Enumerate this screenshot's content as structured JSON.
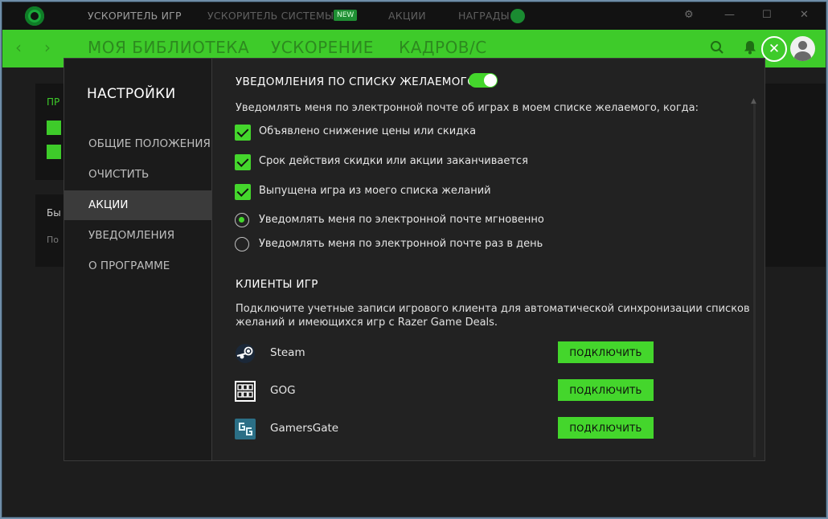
{
  "topbar": {
    "tabs": [
      "УСКОРИТЕЛЬ ИГР",
      "УСКОРИТЕЛЬ СИСТЕМЫ",
      "АКЦИИ",
      "НАГРАДЫ"
    ],
    "new_badge": "NEW",
    "window_buttons": [
      "⚙",
      "—",
      "☐",
      "✕"
    ]
  },
  "header": {
    "tabs": [
      "МОЯ БИБЛИОТЕКА",
      "УСКОРЕНИЕ",
      "КАДРОВ/С"
    ],
    "back": "‹",
    "forward": "›",
    "close": "✕"
  },
  "background_page": {
    "card1_label": "ПР",
    "card2_label": "Бы",
    "card2_text": "По"
  },
  "sidebar": {
    "title": "НАСТРОЙКИ",
    "items": [
      "ОБЩИЕ ПОЛОЖЕНИЯ",
      "ОЧИСТИТЬ",
      "АКЦИИ",
      "УВЕДОМЛЕНИЯ",
      "О ПРОГРАММЕ"
    ],
    "active_index": 2
  },
  "wishlist": {
    "title": "УВЕДОМЛЕНИЯ ПО СПИСКУ ЖЕЛАЕМОГО",
    "toggle_on": true,
    "description": "Уведомлять меня по электронной почте об играх в моем списке желаемого, когда:",
    "checkboxes": [
      {
        "label": "Объявлено снижение цены или скидка",
        "checked": true
      },
      {
        "label": "Срок действия скидки или акции заканчивается",
        "checked": true
      },
      {
        "label": "Выпущена игра из моего списка желаний",
        "checked": true
      }
    ],
    "radios": [
      {
        "label": "Уведомлять меня по электронной почте мгновенно",
        "selected": true
      },
      {
        "label": "Уведомлять меня по электронной почте раз в день",
        "selected": false
      }
    ]
  },
  "clients": {
    "title": "КЛИЕНТЫ ИГР",
    "description_line1": "Подключите учетные записи игрового клиента для автоматической синхронизации списков",
    "description_line2": "желаний и имеющихся игр с Razer Game Deals.",
    "items": [
      {
        "name": "Steam",
        "icon": "steam-icon",
        "button": "ПОДКЛЮЧИТЬ"
      },
      {
        "name": "GOG",
        "icon": "gog-icon",
        "button": "ПОДКЛЮЧИТЬ"
      },
      {
        "name": "GamersGate",
        "icon": "gamersgate-icon",
        "button": "ПОДКЛЮЧИТЬ"
      }
    ]
  },
  "colors": {
    "accent": "#44d62c",
    "header_green": "#3ecb2a",
    "panel": "#222222",
    "sidebar": "#1b1b1b"
  }
}
